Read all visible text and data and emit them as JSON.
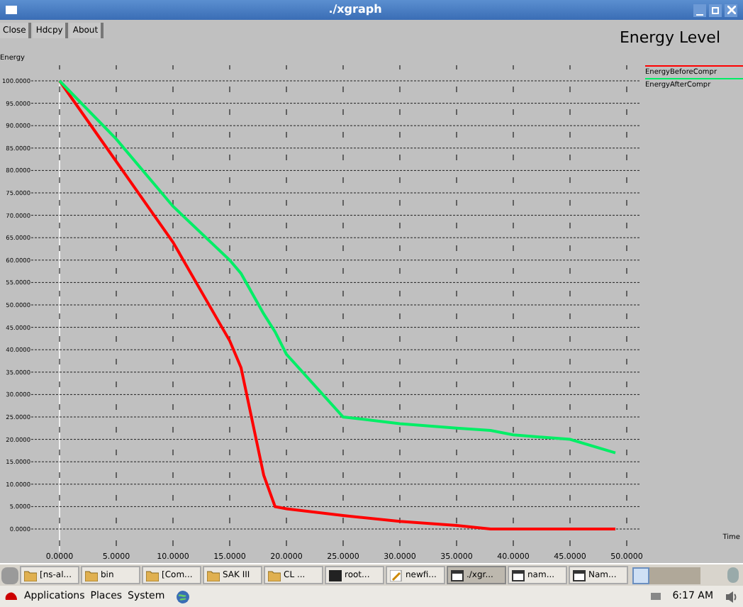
{
  "window": {
    "title": "./xgraph"
  },
  "toolbar": [
    "Close",
    "Hdcpy",
    "About"
  ],
  "plot": {
    "title": "Energy Level",
    "ylabel_text": "Energy",
    "xlabel_text": "Time",
    "chart_data": {
      "type": "line",
      "x": [
        0,
        5,
        10,
        15,
        16,
        18,
        19,
        20,
        25,
        30,
        35,
        38,
        40,
        45,
        49
      ],
      "series": [
        {
          "name": "EnergyBeforeCompr",
          "color": "#ff0000",
          "values": [
            100,
            82,
            64,
            42,
            36,
            12,
            5,
            4.5,
            3,
            1.7,
            0.8,
            0,
            0,
            0,
            0
          ]
        },
        {
          "name": "EnergyAfterCompr",
          "color": "#00ee66",
          "values": [
            100,
            87,
            72,
            60,
            57,
            48,
            44,
            39,
            25,
            23.5,
            22.5,
            22,
            21,
            20,
            17
          ]
        }
      ],
      "xlim": [
        0,
        50
      ],
      "ylim": [
        0,
        100
      ],
      "grid": true,
      "xticks": [
        {
          "value": 0,
          "label": "0.0000"
        },
        {
          "value": 5,
          "label": "5.0000"
        },
        {
          "value": 10,
          "label": "10.0000"
        },
        {
          "value": 15,
          "label": "15.0000"
        },
        {
          "value": 20,
          "label": "20.0000"
        },
        {
          "value": 25,
          "label": "25.0000"
        },
        {
          "value": 30,
          "label": "30.0000"
        },
        {
          "value": 35,
          "label": "35.0000"
        },
        {
          "value": 40,
          "label": "40.0000"
        },
        {
          "value": 45,
          "label": "45.0000"
        },
        {
          "value": 50,
          "label": "50.0000"
        }
      ],
      "yticks": [
        {
          "value": 0,
          "label": "0.0000"
        },
        {
          "value": 5,
          "label": "5.0000"
        },
        {
          "value": 10,
          "label": "10.0000"
        },
        {
          "value": 15,
          "label": "15.0000"
        },
        {
          "value": 20,
          "label": "20.0000"
        },
        {
          "value": 25,
          "label": "25.0000"
        },
        {
          "value": 30,
          "label": "30.0000"
        },
        {
          "value": 35,
          "label": "35.0000"
        },
        {
          "value": 40,
          "label": "40.0000"
        },
        {
          "value": 45,
          "label": "45.0000"
        },
        {
          "value": 50,
          "label": "50.0000"
        },
        {
          "value": 55,
          "label": "55.0000"
        },
        {
          "value": 60,
          "label": "60.0000"
        },
        {
          "value": 65,
          "label": "65.0000"
        },
        {
          "value": 70,
          "label": "70.0000"
        },
        {
          "value": 75,
          "label": "75.0000"
        },
        {
          "value": 80,
          "label": "80.0000"
        },
        {
          "value": 85,
          "label": "85.0000"
        },
        {
          "value": 90,
          "label": "90.0000"
        },
        {
          "value": 95,
          "label": "95.0000"
        },
        {
          "value": 100,
          "label": "100.0000"
        }
      ]
    }
  },
  "taskbar": [
    {
      "label": "[ns-al...",
      "kind": "folder",
      "selected": false
    },
    {
      "label": "bin",
      "kind": "folder",
      "selected": false
    },
    {
      "label": "[Com...",
      "kind": "folder",
      "selected": false
    },
    {
      "label": "SAK III",
      "kind": "folder",
      "selected": false
    },
    {
      "label": "CL ...",
      "kind": "folder",
      "selected": false
    },
    {
      "label": "root...",
      "kind": "terminal",
      "selected": false
    },
    {
      "label": "newfi...",
      "kind": "editor",
      "selected": false
    },
    {
      "label": "./xgr...",
      "kind": "window",
      "selected": true
    },
    {
      "label": "nam...",
      "kind": "window",
      "selected": false
    },
    {
      "label": "Nam...",
      "kind": "window",
      "selected": false
    }
  ],
  "panel": {
    "menus": [
      "Applications",
      "Places",
      "System"
    ],
    "clock": "6:17 AM"
  }
}
